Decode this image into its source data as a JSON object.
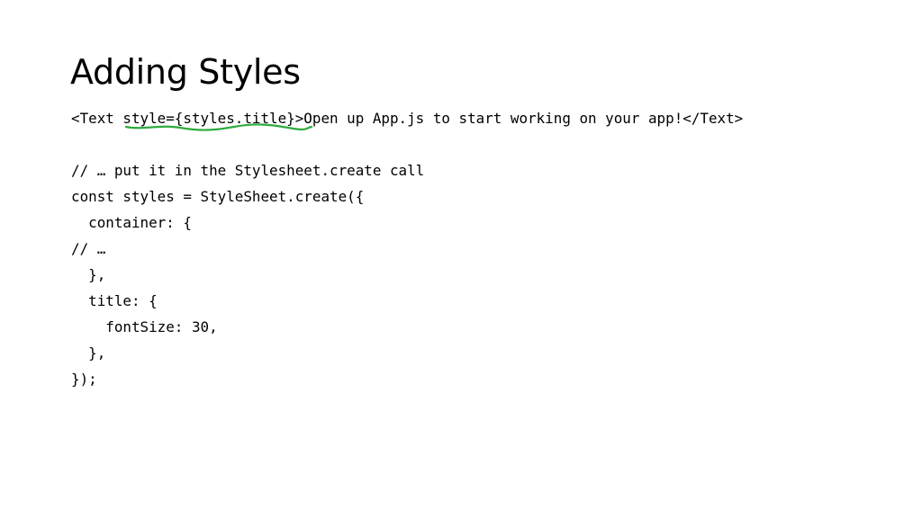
{
  "slide": {
    "title": "Adding Styles",
    "code_lines": [
      "<Text style={styles.title}>Open up App.js to start working on your app!</Text>",
      "",
      "// … put it in the Stylesheet.create call",
      "const styles = StyleSheet.create({",
      "  container: {",
      "// …",
      "  },",
      "  title: {",
      "    fontSize: 30,",
      "  },",
      "});"
    ],
    "highlight_color": "#2eaa3c"
  }
}
